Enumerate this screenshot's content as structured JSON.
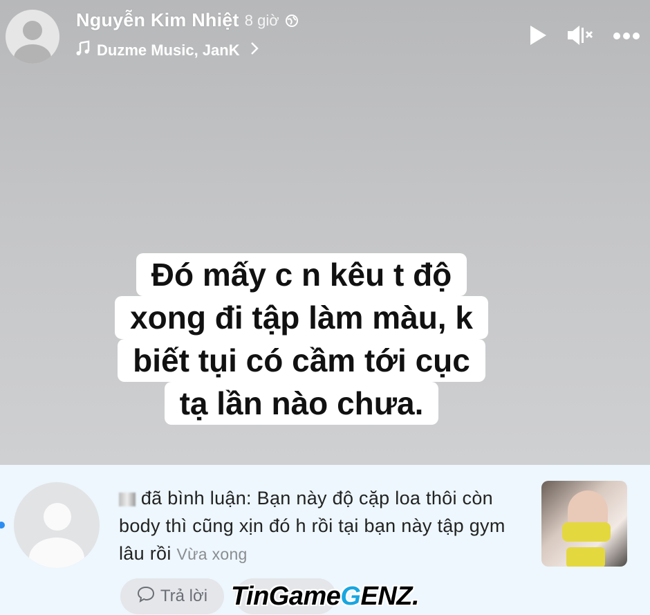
{
  "header": {
    "name": "Nguyễn Kim Nhiệt",
    "time": "8 giờ",
    "music": "Duzme Music, JanK"
  },
  "icons": {
    "play": "play-icon",
    "mute": "mute-icon",
    "more": "more-icon",
    "globe": "globe-icon",
    "music": "music-note-icon",
    "chevron": "chevron-right-icon"
  },
  "caption": {
    "line1": "Đó mấy c  n kêu t độ",
    "line2": "xong đi tập làm màu, k",
    "line3": "biết tụi    có cầm tới cục",
    "line4": "tạ lần nào chưa."
  },
  "notification": {
    "action": "đã bình luận: Bạn này độ cặp loa thôi còn body thì cũng xịn đó h rồi tại bạn này tập gym lâu rồi",
    "time": "Vừa xong",
    "reply_label": "Trả lời"
  },
  "watermark": {
    "prefix": "TinGame",
    "accent": "G",
    "suffix": "ENZ."
  },
  "colors": {
    "notif_bg": "#edf7fd",
    "unread_dot": "#2d8df0",
    "watermark_accent": "#18a6e0"
  }
}
